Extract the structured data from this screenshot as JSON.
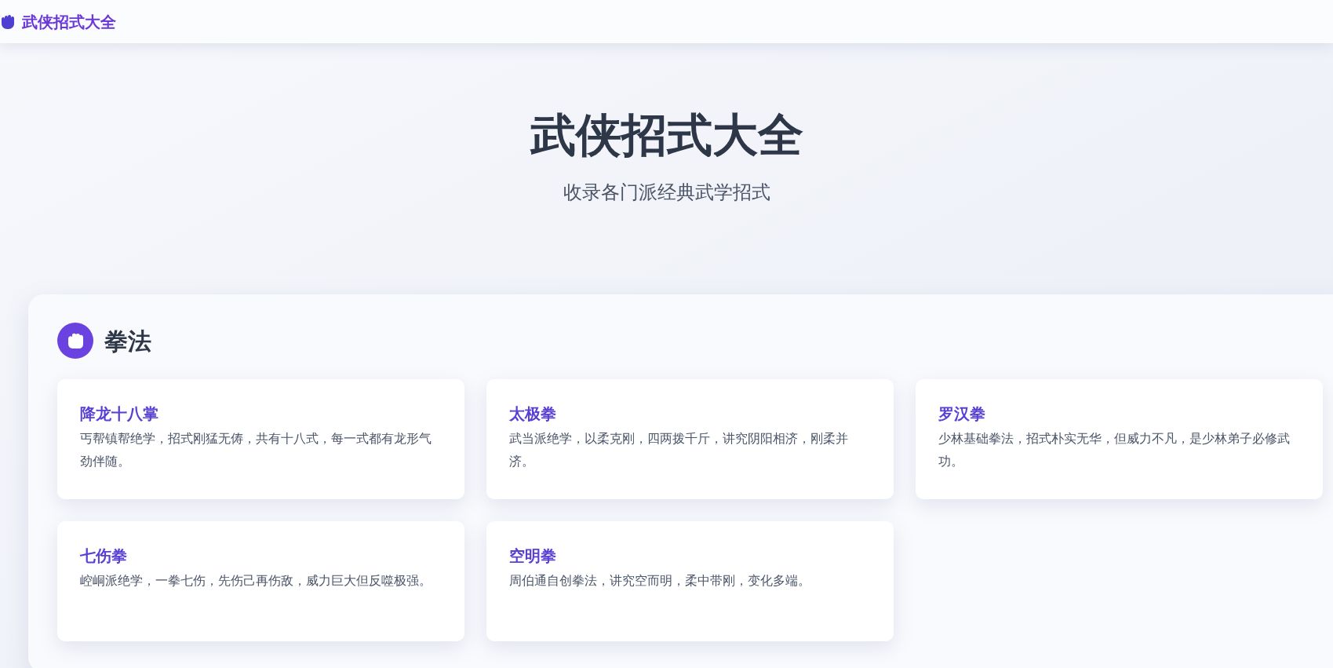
{
  "navbar": {
    "logo": "武侠招式大全"
  },
  "hero": {
    "title": "武侠招式大全",
    "subtitle": "收录各门派经典武学招式"
  },
  "sections": [
    {
      "title": "拳法",
      "moves": [
        {
          "name": "降龙十八掌",
          "description": "丐帮镇帮绝学，招式刚猛无俦，共有十八式，每一式都有龙形气劲伴随。"
        },
        {
          "name": "太极拳",
          "description": "武当派绝学，以柔克刚，四两拨千斤，讲究阴阳相济，刚柔并济。"
        },
        {
          "name": "罗汉拳",
          "description": "少林基础拳法，招式朴实无华，但威力不凡，是少林弟子必修武功。"
        },
        {
          "name": "七伤拳",
          "description": "崆峒派绝学，一拳七伤，先伤己再伤敌，威力巨大但反噬极强。"
        },
        {
          "name": "空明拳",
          "description": "周伯通自创拳法，讲究空而明，柔中带刚，变化多端。"
        }
      ]
    }
  ]
}
